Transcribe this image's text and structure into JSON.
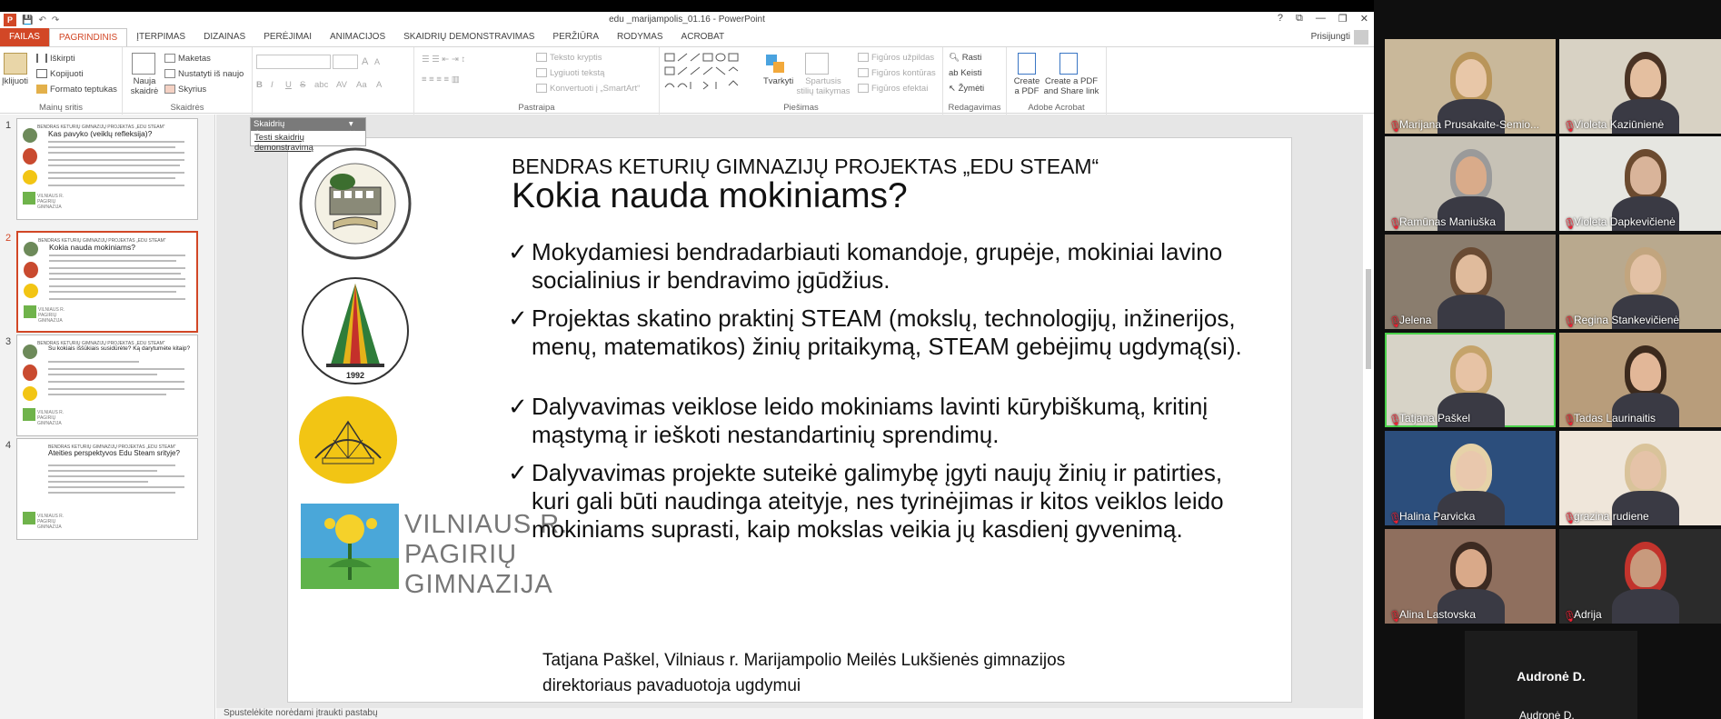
{
  "window": {
    "title": "edu _marijampolis_01.16 - PowerPoint",
    "app_icon": "P",
    "help": "?",
    "restore": "⧉",
    "minimize": "—",
    "maximize": "❐",
    "close": "✕"
  },
  "quick_access": {
    "save": "💾",
    "undo": "↶",
    "redo": "↷"
  },
  "tabs": [
    "FAILAS",
    "PAGRINDINIS",
    "ĮTERPIMAS",
    "DIZAINAS",
    "PERĖJIMAI",
    "ANIMACIJOS",
    "SKAIDRIŲ DEMONSTRAVIMAS",
    "PERŽIŪRA",
    "RODYMAS",
    "ACROBAT"
  ],
  "active_tab": "PAGRINDINIS",
  "sign_in": "Prisijungti",
  "ribbon": {
    "clipboard": {
      "label": "Mainų sritis",
      "paste": "Įklijuoti",
      "cut": "Iškirpti",
      "copy": "Kopijuoti",
      "format_painter": "Formato teptukas"
    },
    "slides": {
      "label": "Skaidrės",
      "new_slide": "Nauja skaidrė",
      "layout": "Maketas",
      "reset": "Nustatyti iš naujo",
      "section": "Skyrius"
    },
    "font": {
      "buttons": [
        "B",
        "I",
        "U",
        "S",
        "abc",
        "AV",
        "Aa",
        "A"
      ],
      "grow": "A",
      "shrink": "A"
    },
    "paragraph": {
      "label": "Pastraipa",
      "direction": "Teksto kryptis",
      "align": "Lygiuoti tekstą",
      "smartart": "Konvertuoti į „SmartArt“"
    },
    "drawing": {
      "label": "Piešimas",
      "arrange": "Tvarkyti",
      "quick_styles": "Spartusis stilių taikymas",
      "fill": "Figūros užpildas",
      "outline": "Figūros kontūras",
      "effects": "Figūros efektai"
    },
    "editing": {
      "label": "Redagavimas",
      "find": "Rasti",
      "replace": "Keisti",
      "select": "Žymėti"
    },
    "acrobat": {
      "label": "Adobe Acrobat",
      "create_pdf": "Create a PDF",
      "create_share": "Create a PDF and Share link"
    }
  },
  "popup": {
    "title": "Skaidrių demonstravimas",
    "item": "Testi skaidrių demonstravimą"
  },
  "thumbnails": [
    {
      "num": "1",
      "tag": "BENDRAS KETURIŲ GIMNAZIJŲ PROJEKTAS „EDU STEAM“",
      "title": "Kas pavyko (veiklų refleksija)?",
      "pagiriu": "VILNIAUS R. PAGIRIŲ GIMNAZIJA"
    },
    {
      "num": "2",
      "tag": "BENDRAS KETURIŲ GIMNAZIJŲ PROJEKTAS „EDU STEAM“",
      "title": "Kokia nauda mokiniams?",
      "pagiriu": "VILNIAUS R. PAGIRIŲ GIMNAZIJA"
    },
    {
      "num": "3",
      "tag": "BENDRAS KETURIŲ GIMNAZIJŲ PROJEKTAS „EDU STEAM“",
      "title": "Su kokiais iššūkiais susidūrėte? Ką darytumėte kitaip?",
      "pagiriu": "VILNIAUS R. PAGIRIŲ GIMNAZIJA"
    },
    {
      "num": "4",
      "tag": "BENDRAS KETURIŲ GIMNAZIJŲ PROJEKTAS „EDU STEAM“",
      "title": "Ateities perspektyvos Edu Steam srityje?",
      "pagiriu": "VILNIAUS R. PAGIRIŲ GIMNAZIJA"
    }
  ],
  "slide": {
    "tag": "BENDRAS KETURIŲ GIMNAZIJŲ PROJEKTAS „EDU STEAM“",
    "heading": "Kokia nauda mokiniams?",
    "check": "✓",
    "bullets": [
      "Mokydamiesi bendradarbiauti komandoje, grupėje, mokiniai lavino socialinius ir bendravimo įgūdžius.",
      "Projektas skatino praktinį STEAM (mokslų, technologijų, inžinerijos, menų, matematikos) žinių pritaikymą, STEAM gebėjimų ugdymą(si).",
      "Dalyvavimas veiklose leido mokiniams lavinti kūrybiškumą, kritinį mąstymą ir ieškoti nestandartinių sprendimų.",
      "Dalyvavimas projekte suteikė galimybę įgyti naujų žinių ir patirties, kuri gali būti naudinga ateityje, nes tyrinėjimas ir kitos veiklos leido mokiniams suprasti, kaip mokslas veikia jų kasdienį gyvenimą."
    ],
    "footer_line1": "Tatjana Paškel, Vilniaus r. Marijampolio Meilės Lukšienės gimnazijos",
    "footer_line2": "direktoriaus pavaduotoja ugdymui",
    "logo_marijampolio": "Vilniaus r. Marijampolio Meilės Lukšienės gimnazija",
    "logo_paberzes": "PABERŽĖS „VERDENĖS“ GIMNAZIJA",
    "logo_paberzes_year": "1992",
    "logo_rudaminos": "VILNIAUS R. RUDAMINOS „RYTO“ GIMNAZIJA",
    "pagiriu_l1": "VILNIAUS R.",
    "pagiriu_l2": "PAGIRIŲ",
    "pagiriu_l3": "GIMNAZIJA"
  },
  "notes_placeholder": "Spustelėkite norėdami įtraukti pastabų",
  "participants": [
    {
      "name": "Marijana Prusakaite-Semio...",
      "bg": "#c9b89a",
      "skin": "#e8c7a8",
      "hair": "#b9955a"
    },
    {
      "name": "Violeta Kaziūnienė",
      "bg": "#d8d2c4",
      "skin": "#e4bfa0",
      "hair": "#4a3324"
    },
    {
      "name": "Ramūnas Maniuška",
      "bg": "#c7c2b6",
      "skin": "#d9ab8a",
      "hair": "#9a9a9a"
    },
    {
      "name": "Violeta Dapkevičienė",
      "bg": "#e6e6e1",
      "skin": "#d9b49a",
      "hair": "#6b4a2f"
    },
    {
      "name": "Jelena",
      "bg": "#8a7d6e",
      "skin": "#e0bb9c",
      "hair": "#6a4b33"
    },
    {
      "name": "Regina Stankevičienė",
      "bg": "#b9a98e",
      "skin": "#e3c1a5",
      "hair": "#c2a57e"
    },
    {
      "name": "Tatjana Paškel",
      "bg": "#d7d3c7",
      "skin": "#e7c3a5",
      "hair": "#c5a36a"
    },
    {
      "name": "Tadas Laurinaitis",
      "bg": "#b89d7b",
      "skin": "#e2b798",
      "hair": "#3c2a1d"
    },
    {
      "name": "Halina Parvicka",
      "bg": "#2c4e7c",
      "skin": "#e9c8ad",
      "hair": "#e6d2a8"
    },
    {
      "name": "grazina rudiene",
      "bg": "#efe6da",
      "skin": "#e5c3a8",
      "hair": "#d9c39a"
    },
    {
      "name": "Alina Lastovska",
      "bg": "#8f6f5e",
      "skin": "#d9a989",
      "hair": "#3d2a21"
    },
    {
      "name": "Adrija",
      "bg": "#2b2b2b",
      "skin": "#c89a7d",
      "hair": "#c2332c"
    }
  ],
  "active_speaker": "Audronė D.",
  "active_speaker_bottom": "Audronė D."
}
